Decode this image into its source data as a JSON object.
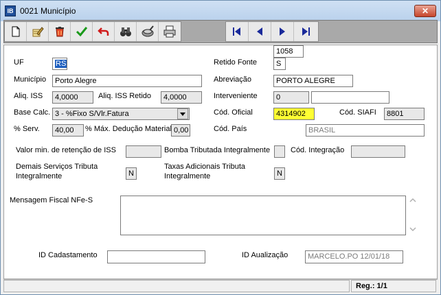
{
  "window": {
    "title": "0021 Município",
    "app_icon_text": "IB",
    "close_glyph": "✕"
  },
  "toolbar": {
    "buttons": [
      {
        "name": "new-icon"
      },
      {
        "name": "edit-icon"
      },
      {
        "name": "delete-icon"
      },
      {
        "name": "confirm-check-icon"
      },
      {
        "name": "undo-icon"
      },
      {
        "name": "search-binoculars-icon"
      },
      {
        "name": "filter-icon"
      },
      {
        "name": "print-icon"
      }
    ],
    "nav": [
      {
        "name": "first-record-icon"
      },
      {
        "name": "previous-record-icon"
      },
      {
        "name": "next-record-icon"
      },
      {
        "name": "last-record-icon"
      }
    ]
  },
  "form": {
    "uf": {
      "label": "UF",
      "value": "RS"
    },
    "municipio": {
      "label": "Município",
      "value": "Porto Alegre"
    },
    "aliq_iss": {
      "label": "Aliq. ISS",
      "value": "4,0000"
    },
    "aliq_iss_retido": {
      "label": "Aliq. ISS Retido",
      "value": "4,0000"
    },
    "base_calc": {
      "label": "Base Calc.",
      "value": "3 - %Fixo S/Vlr.Fatura"
    },
    "perc_serv": {
      "label": "% Serv.",
      "value": "40,00"
    },
    "perc_max_deducao": {
      "label": "% Máx. Dedução Material",
      "value": "0,00"
    },
    "retido_fonte": {
      "label": "Retido Fonte",
      "value": "S"
    },
    "abreviacao": {
      "label": "Abreviação",
      "value": "PORTO ALEGRE"
    },
    "interveniente": {
      "label": "Interveniente",
      "code": "0",
      "name": ""
    },
    "cod_oficial": {
      "label": "Cód. Oficial",
      "value": "4314902"
    },
    "cod_siafi": {
      "label": "Cód. SIAFI",
      "value": "8801"
    },
    "cod_pais": {
      "label": "Cód. País",
      "code": "1058",
      "name": "BRASIL"
    },
    "valor_min_retencao": {
      "label": "Valor min. de retenção de ISS",
      "value": ""
    },
    "bomba_tributada": {
      "label": "Bomba Tributada Integralmente",
      "value": ""
    },
    "cod_integracao": {
      "label": "Cód. Integração",
      "value": ""
    },
    "demais_servicos": {
      "label_line1": "Demais Serviços Tributa",
      "label_line2": "Integralmente",
      "value": "N"
    },
    "taxas_adicionais": {
      "label_line1": "Taxas Adicionais Tributa",
      "label_line2": "Integralmente",
      "value": "N"
    },
    "mensagem_fiscal": {
      "label": "Mensagem Fiscal NFe-S",
      "value": ""
    },
    "id_cadastramento": {
      "label": "ID Cadastamento",
      "value": ""
    },
    "id_atualizacao": {
      "label": "ID Aualização",
      "value": "MARCELO.PO 12/01/18"
    }
  },
  "status": {
    "left": "",
    "record": "Reg.: 1/1"
  },
  "colors": {
    "highlight_yellow": "#ffff33",
    "selection_blue": "#1e5fbf",
    "toolbar_gray": "#a9a9a9"
  }
}
